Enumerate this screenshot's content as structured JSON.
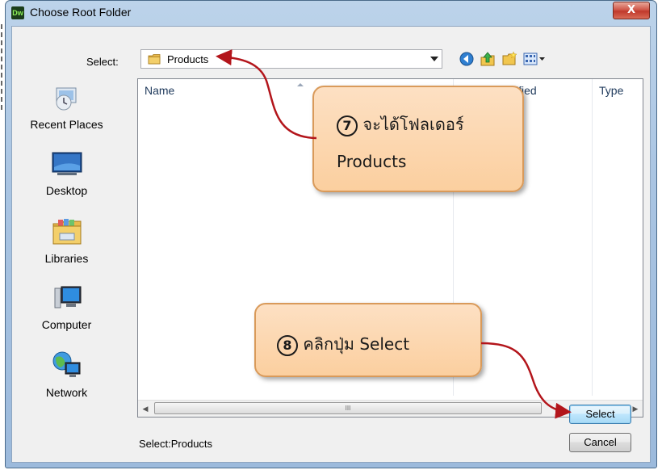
{
  "window": {
    "app_icon_text": "Dw",
    "title": "Choose Root Folder",
    "close_glyph": "X"
  },
  "toolbar": {
    "select_label": "Select:",
    "path_value": "Products",
    "icons": [
      "back-icon",
      "up-folder-icon",
      "new-folder-icon",
      "view-menu-icon"
    ]
  },
  "places": [
    {
      "label": "Recent Places",
      "icon": "recent-places-icon"
    },
    {
      "label": "Desktop",
      "icon": "desktop-icon"
    },
    {
      "label": "Libraries",
      "icon": "libraries-icon"
    },
    {
      "label": "Computer",
      "icon": "computer-icon"
    },
    {
      "label": "Network",
      "icon": "network-icon"
    }
  ],
  "file_list": {
    "columns": [
      "Name",
      "Date modified",
      "Type"
    ],
    "visible_header_fragments": [
      "Name",
      "ified",
      "Type"
    ],
    "empty_text_fragment": "N",
    "scroll_thumb_grip": "III"
  },
  "status": {
    "selection_text": "Select:Products"
  },
  "buttons": {
    "select_label": "Select",
    "cancel_label": "Cancel"
  },
  "annotations": {
    "callout7": {
      "marker": "7",
      "text": "จะได้โฟลเดอร์",
      "text2": "Products"
    },
    "callout8": {
      "marker": "8",
      "text": "คลิกปุ่ม Select"
    },
    "arrow_color": "#b3151b",
    "callout_fill": "#fbd3a8"
  },
  "colors": {
    "title_bar": "#a9c4e2",
    "close_button": "#c0392b",
    "default_button_border": "#3c7fb1"
  }
}
